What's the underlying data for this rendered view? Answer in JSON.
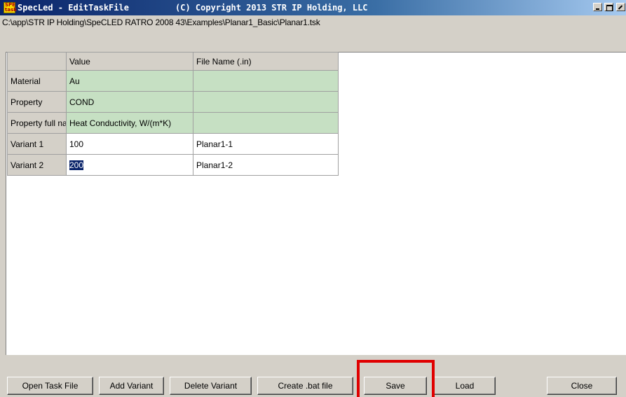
{
  "window": {
    "app_icon_label": "SPE task",
    "title": "SpecLed - EditTaskFile",
    "copyright": "(C) Copyright  2013 STR IP Holding, LLC"
  },
  "path": "C:\\app\\STR IP Holding\\SpeCLED RATRO 2008 43\\Examples\\Planar1_Basic\\Planar1.tsk",
  "grid": {
    "headers": [
      "",
      "Value",
      "File Name (.in)"
    ],
    "rows": [
      {
        "label": "Material",
        "value": "Au",
        "file": "",
        "style": "green"
      },
      {
        "label": "Property",
        "value": "COND",
        "file": "",
        "style": "green"
      },
      {
        "label": "Property full name",
        "value": "Heat Conductivity, W/(m*K)",
        "file": "",
        "style": "green"
      },
      {
        "label": "Variant 1",
        "value": "100",
        "file": "Planar1-1",
        "style": "white"
      },
      {
        "label": "Variant 2",
        "value": "200",
        "file": "Planar1-2",
        "style": "white",
        "selected": true
      }
    ]
  },
  "buttons": {
    "open": "Open Task File",
    "add": "Add Variant",
    "delete": "Delete Variant",
    "create_bat": "Create .bat file",
    "save": "Save",
    "load": "Load",
    "close": "Close"
  }
}
